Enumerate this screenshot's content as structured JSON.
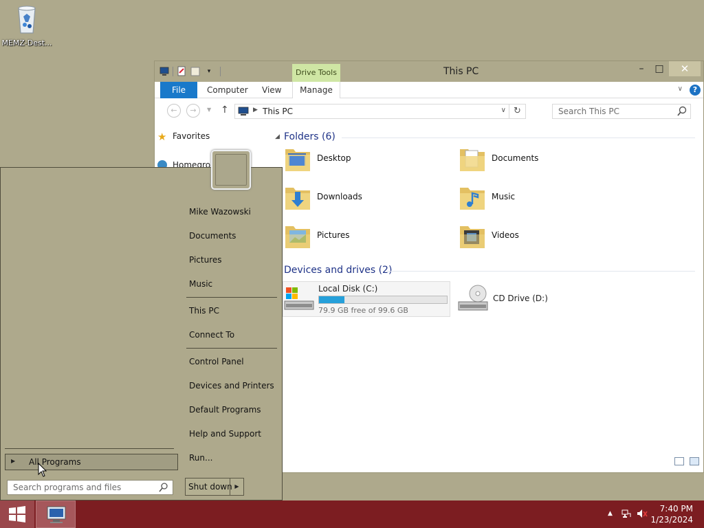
{
  "desktop": {
    "icons": [
      {
        "label": "MEMZ-Dest...",
        "icon": "recycle-bin-icon"
      }
    ],
    "background_color": "#aea98c"
  },
  "explorer": {
    "title": "This PC",
    "contextual_tab": "Drive Tools",
    "ribbon_tabs": {
      "file": "File",
      "computer": "Computer",
      "view": "View",
      "manage": "Manage"
    },
    "address": {
      "path": "This PC"
    },
    "search": {
      "placeholder": "Search This PC"
    },
    "nav_pane": {
      "favorites": "Favorites",
      "homegroup": "Homegroup"
    },
    "folders_header": "Folders (6)",
    "folders": [
      {
        "label": "Desktop",
        "icon": "desktop-folder-icon"
      },
      {
        "label": "Documents",
        "icon": "documents-folder-icon"
      },
      {
        "label": "Downloads",
        "icon": "downloads-folder-icon"
      },
      {
        "label": "Music",
        "icon": "music-folder-icon"
      },
      {
        "label": "Pictures",
        "icon": "pictures-folder-icon"
      },
      {
        "label": "Videos",
        "icon": "videos-folder-icon"
      }
    ],
    "devices_header": "Devices and drives (2)",
    "drives": {
      "local": {
        "label": "Local Disk (C:)",
        "free_text": "79.9 GB free of 99.6 GB",
        "used_fraction": 0.2
      },
      "cd": {
        "label": "CD Drive (D:)"
      }
    },
    "accent_color": "#1979ca"
  },
  "start_menu": {
    "user_name": "Mike Wazowski",
    "right_items": {
      "user": "Mike Wazowski",
      "documents": "Documents",
      "pictures": "Pictures",
      "music": "Music",
      "this_pc": "This PC",
      "connect_to": "Connect To",
      "control_panel": "Control Panel",
      "devices_printers": "Devices and Printers",
      "default_programs": "Default Programs",
      "help_support": "Help and Support",
      "run": "Run..."
    },
    "all_programs": "All Programs",
    "search_placeholder": "Search programs and files",
    "shutdown_label": "Shut down"
  },
  "taskbar": {
    "color": "#7c1d21",
    "clock": {
      "time": "7:40 PM",
      "date": "1/23/2024"
    }
  }
}
